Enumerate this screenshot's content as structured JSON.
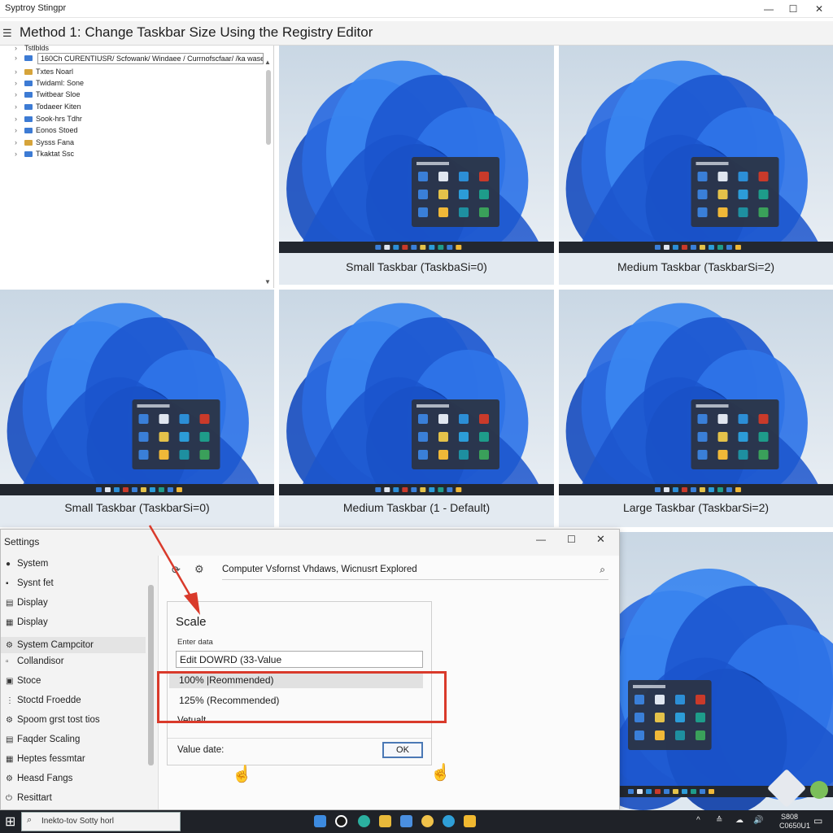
{
  "window": {
    "title": "Syptroy Stingpr",
    "controls": {
      "minimize": "—",
      "maximize": "☐",
      "close": "✕"
    }
  },
  "heading": {
    "icon": "list-icon",
    "text": "Method 1: Change Taskbar Size Using the Registry Editor"
  },
  "registry": {
    "path": "160Ch CURENTIUSR/ Scfowank/ Windaee / Currnofscfaar/ /ka wase",
    "items": [
      "Tstlblds",
      "Txtes Noarl",
      "Twidaml: Sone",
      "Twitbear Sloe",
      "Todaeer Kiten",
      "Sook-hrs Tdhr",
      "Eonos Stoed",
      "Sysss Fana",
      "Tkaktat Ssc"
    ]
  },
  "tiles": [
    {
      "caption": "Small Taskbar (TaskbaSi=0)",
      "mini_title": "Illoemoscm"
    },
    {
      "caption": "Medium Taskbar (TaskbarSi=2)",
      "mini_title": "Illoemoscm"
    },
    {
      "caption": "Small Taskbar (TaskbarSi=0)",
      "mini_title": "Illoemoscm"
    },
    {
      "caption": "Medium Taskbar (1 - Default)",
      "mini_title": "Illoemoscm"
    },
    {
      "caption": "Large Taskbar (TaskbarSi=2)",
      "mini_title": "Illoemoscm"
    },
    {
      "caption": "",
      "mini_title": "Illoemoscm"
    }
  ],
  "settings": {
    "title": "Settings",
    "nav": [
      "System",
      "Sysnt fet",
      "Display",
      "Display",
      "System Campcitor",
      "Collandisor",
      "Stoce",
      "Stoctd Froedde",
      "Spoom grst tost tios",
      "Faqder Scaling",
      "Heptes fessmtar",
      "Heasd Fangs",
      "Resittart"
    ],
    "nav_icons": [
      "user-icon",
      "account-icon",
      "display-icon",
      "monitor-icon",
      "computer-icon",
      "controller-icon",
      "storage-icon",
      "settings-icon",
      "accessibility-icon",
      "scaling-icon",
      "keyboard-icon",
      "language-icon",
      "power-icon"
    ],
    "address": "Computer Vsfornst Vhdaws, Wicnusrt Explored",
    "scale_title": "Scale",
    "field_label": "Enter data",
    "edit_value": "Edit DOWRD (33-Value",
    "option_selected": "100% |Reommended)",
    "option2": "125% (Recommended)",
    "option3": "Vetualt",
    "value_label": "Value date:",
    "ok_label": "OK"
  },
  "taskbar": {
    "search": "Inekto-tov Sotty horl",
    "clock_time": "S808",
    "clock_date": "C0650U1",
    "tray": [
      "^",
      "≙",
      "☁",
      "🔊"
    ]
  },
  "colors": {
    "highlight_red": "#d93a2b",
    "accent_blue": "#2f6fd6",
    "wallpaper_bg": "#dce6ee",
    "bloom_blue": "#1f5fd8",
    "taskbar": "#1f2228"
  }
}
